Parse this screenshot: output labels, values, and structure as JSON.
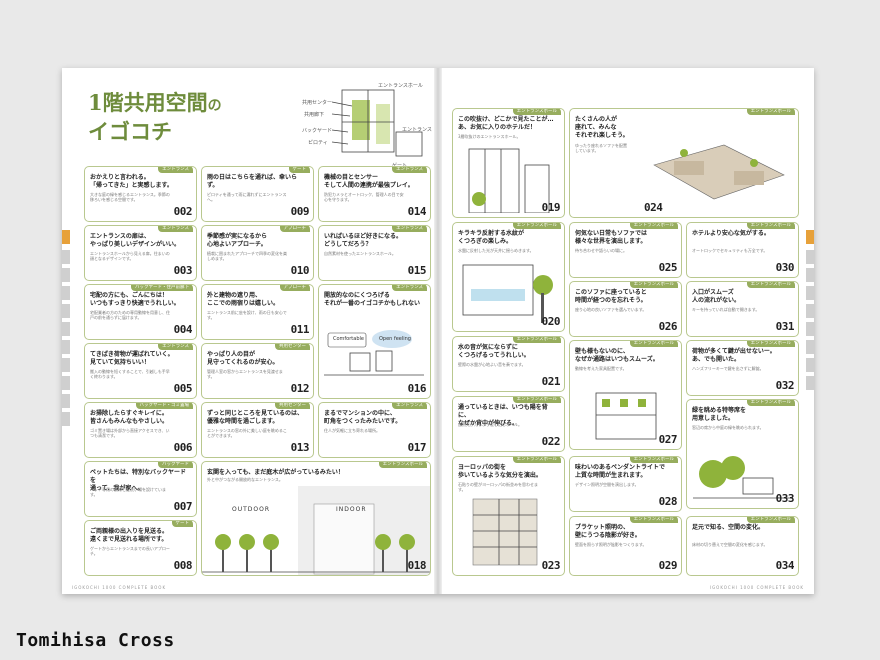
{
  "brand": "Tomihisa Cross",
  "left": {
    "title_main": "1階共用空間",
    "title_small": "の",
    "title_line2": "イゴコチ",
    "map_labels": [
      "エントランスホール",
      "共用センター",
      "共用廊下",
      "バックヤード",
      "ピロティ",
      "エントランス",
      "ゲート"
    ],
    "cards": [
      {
        "num": "001",
        "tag": "エントランス",
        "head": "おかえりと言われる。\n「帰ってきた」と実感します。",
        "body": "大きな庭の緑を感じるエントランス。季節の移ろいを感じる空間です。"
      },
      {
        "num": "002",
        "tag": "",
        "head": "",
        "body": ""
      },
      {
        "num": "003",
        "tag": "エントランス",
        "head": "エントランスの扉は、\nやっぱり美しいデザインがいい。",
        "body": "エントランスホールから見える扉。住まいの顔となるデザインです。"
      },
      {
        "num": "004",
        "tag": "バックヤード・住戸前廊下",
        "head": "宅配の方にも、ごんにちは！\nいつもすっきり快適でうれしい。",
        "body": "宅配業者の方のための専用動線を用意し、住戸の前を通らずに届けます。"
      },
      {
        "num": "005",
        "tag": "エントランス",
        "head": "てきぱき荷物が運ばれていく。\n見ていて気持ちいい！",
        "body": "搬入の動線を短くすることで、引越しも手早く終わります。"
      },
      {
        "num": "006",
        "tag": "バックヤード・ゴミ置場",
        "head": "お掃除したらすぐキレイに。\n皆さんもみんなもやさしい。",
        "body": "ゴミ置き場は外部から直接アクセスでき、いつも清潔です。"
      },
      {
        "num": "007",
        "tag": "バックヤード",
        "head": "ベットたちは、特別なバックヤードを\n通って、我が家へ。",
        "body": "ペット専用の動線と足洗い場を設けています。"
      },
      {
        "num": "008",
        "tag": "ゲート",
        "head": "ご両親様の出入りを見送る。\n遠くまで見送れる場所です。",
        "body": "ゲートからエントランスまでの長いアプローチ。"
      },
      {
        "num": "009",
        "tag": "ゲート",
        "head": "雨の日はこちらを通れば、傘いらず。",
        "body": "ピロティを通って雨に濡れずにエントランスへ。"
      },
      {
        "num": "010",
        "tag": "アプローチ",
        "head": "季節感が実になるから\n心地よいアプローチ。",
        "body": "植栽に囲まれたアプローチで四季の変化を楽しめます。"
      },
      {
        "num": "011",
        "tag": "アプローチ",
        "head": "外と建物の遮り用、\nここでの雨宿りは嬉しい。",
        "body": "エントランス前に庇を設け、雨の日も安心です。"
      },
      {
        "num": "012",
        "tag": "共用センター",
        "head": "やっぱり人の目が\n見守ってくれるのが安心。",
        "body": "管理人室の窓からエントランスを見渡せます。"
      },
      {
        "num": "013",
        "tag": "共用センター",
        "head": "ずっと同じところを見ているのは、\n優雅な時間を過ごします。",
        "body": "エントランスの窓の外に美しい庭を眺めることができます。"
      },
      {
        "num": "014",
        "tag": "エントランス",
        "head": "機械の目とセンサー\nそして人間の連携が最強プレイ。",
        "body": "防犯カメラとオートロック、管理人の目で安心を守ります。"
      },
      {
        "num": "015",
        "tag": "エントランス",
        "head": "いればいるほど好きになる。\nどうしてだろう？",
        "body": "自然素材を使ったエントランスホール。"
      },
      {
        "num": "016",
        "tag": "エントランス",
        "head": "開放的なのにくつろげる\nそれが一番のイゴコチかもしれない",
        "body": "",
        "illus": true
      },
      {
        "num": "017",
        "tag": "エントランス",
        "head": "まるでマンションの中に、\n町角をつくったみたいです。",
        "body": "住人が気軽に立ち寄れる場所。"
      },
      {
        "num": "018",
        "tag": "エントランスホール",
        "head": "玄関を入っても、まだ庭木が広がっているみたい！",
        "body": "外と中がつながる開放的なエントランス。",
        "illus": true
      }
    ],
    "illus_texts": {
      "comfortable": "Comfortable",
      "open": "Open feeling",
      "outdoor": "OUTDOOR",
      "indoor": "INDOOR"
    },
    "footer": "IGOKOCHI 1000 COMPLETE BOOK"
  },
  "right": {
    "cards": [
      {
        "num": "019",
        "tag": "エントランスホール",
        "head": "この吹抜け、どこかで見たことが…\nあ、お気に入りのホテルだ！",
        "body": "3層吹抜けのエントランスホール。"
      },
      {
        "num": "020",
        "tag": "エントランスホール",
        "head": "キラキラ反射する水紋が\nくつろぎの楽しみ。",
        "body": "水盤に反射した光が天井に揺らめきます。"
      },
      {
        "num": "021",
        "tag": "エントランスホール",
        "head": "水の音が気にならずに\nくつろげるってうれしい。",
        "body": "壁際の水盤が心地よい音を奏でます。"
      },
      {
        "num": "022",
        "tag": "エントランスホール",
        "head": "通っているときは、いつも陽を背に、\nなぜか背中が伸びる。",
        "body": "自然光がたっぷり差し込むホール。"
      },
      {
        "num": "023",
        "tag": "エントランスホール",
        "head": "ヨーロッパの街を\n歩いているような気分を演出。",
        "body": "石貼りの壁がヨーロッパの街並みを思わせます。"
      },
      {
        "num": "024",
        "tag": "エントランスホール",
        "head": "たくさんの人が\n座れて、みんな\nそれぞれ楽しそう。",
        "body": "ゆったり座れるソファを配置しています。"
      },
      {
        "num": "025",
        "tag": "エントランスホール",
        "head": "何気ない日常もソファでは\n様々な世界を演出します。",
        "body": "待ち合わせや語らいの場に。"
      },
      {
        "num": "026",
        "tag": "エントランスホール",
        "head": "このソファに座っていると\n時間が経つのを忘れそう。",
        "body": "座り心地の良いソファを選んでいます。"
      },
      {
        "num": "027",
        "tag": "エントランスホール",
        "head": "壁も様もないのに、\nなぜか通路はいつもスムーズ。",
        "body": "動線を考えた家具配置です。"
      },
      {
        "num": "028",
        "tag": "エントランスホール",
        "head": "味わいのあるペンダントライトで\n上質な時間が生まれます。",
        "body": "デザイン照明が空間を演出します。"
      },
      {
        "num": "029",
        "tag": "エントランスホール",
        "head": "ブラケット照明の、\n壁にうつる陰影が好き。",
        "body": "壁面を照らす照明が陰影をつくります。"
      },
      {
        "num": "030",
        "tag": "エントランスホール",
        "head": "ホテルより安心な気がする。",
        "body": "オートロックでセキュリティも万全です。"
      },
      {
        "num": "031",
        "tag": "エントランスホール",
        "head": "入口がスムーズ\n人の流れがない。",
        "body": "キーを持っていれば自動で開きます。"
      },
      {
        "num": "032",
        "tag": "エントランスホール",
        "head": "荷物が多くて鍵が出せないー。\nあ、でも開いた。",
        "body": "ハンズフリーキーで鍵を出さずに解錠。"
      },
      {
        "num": "033",
        "tag": "エントランスホール",
        "head": "緑を眺める特等席を\n用意しました。",
        "body": "窓辺の席から中庭の緑を眺められます。"
      },
      {
        "num": "034",
        "tag": "エントランスホール",
        "head": "足元で知る、空間の変化。",
        "body": "床材の切り替えで空間の変化を感じます。"
      }
    ],
    "footer": "IGOKOCHI 1000 COMPLETE BOOK"
  }
}
